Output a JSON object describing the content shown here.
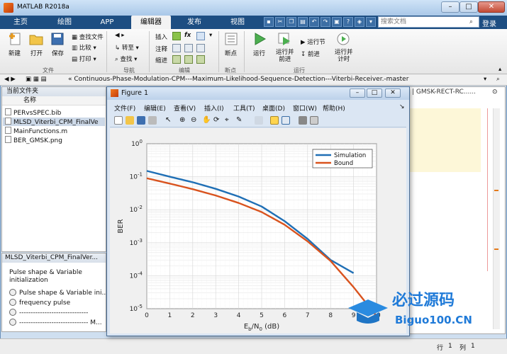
{
  "window": {
    "title": "MATLAB R2018a"
  },
  "tabs": [
    {
      "label": "主页"
    },
    {
      "label": "绘图"
    },
    {
      "label": "APP"
    },
    {
      "label": "编辑器"
    },
    {
      "label": "发布"
    },
    {
      "label": "视图"
    }
  ],
  "search": {
    "placeholder": "搜索文档"
  },
  "login_label": "登录",
  "ribbon": {
    "file": {
      "new": "新建",
      "open": "打开",
      "save": "保存",
      "find_files": "查找文件",
      "compare": "比较",
      "print": "打印",
      "section": "文件"
    },
    "nav": {
      "goto": "转至",
      "find": "查找",
      "section": "导航"
    },
    "edit": {
      "insert": "插入",
      "comment": "注释",
      "indent": "缩进",
      "fx": "fx",
      "section": "编辑"
    },
    "breakpoints": {
      "label": "断点",
      "section": "断点"
    },
    "run": {
      "run": "运行",
      "run_advance": "运行并\n前进",
      "run_section": "运行节",
      "advance": "前进",
      "run_time": "运行并\n计时",
      "section": "运行"
    }
  },
  "address": {
    "path": "« Continuous-Phase-Modulation-CPM---Maximum-Likelihood-Sequence-Detection---Viterbi-Receiver.-master"
  },
  "current_folder": {
    "title": "当前文件夹",
    "column": "名称",
    "files": [
      {
        "name": "PERvsSPEC.bib"
      },
      {
        "name": "MLSD_Viterbi_CPM_FinalVe"
      },
      {
        "name": "MainFunctions.m"
      },
      {
        "name": "BER_GMSK.png"
      }
    ]
  },
  "details": {
    "title": "MLSD_Viterbi_CPM_FinalVer...",
    "desc_line1": "Pulse shape & Variable",
    "desc_line2": "initialization",
    "items": [
      "Pulse shape & Variable ini...",
      "frequency pulse",
      "------------------------------",
      "------------------------------ M..."
    ]
  },
  "editor": {
    "crumb": "| GMSK-RECT-RC......"
  },
  "status": {
    "row_label": "行",
    "row": "1",
    "col_label": "列",
    "col": "1"
  },
  "figure": {
    "title": "Figure 1",
    "menu": [
      "文件(F)",
      "编辑(E)",
      "查看(V)",
      "插入(I)",
      "工具(T)",
      "桌面(D)",
      "窗口(W)",
      "帮助(H)"
    ]
  },
  "chart_data": {
    "type": "line",
    "title": "",
    "xlabel": "Eb/N0 (dB)",
    "ylabel": "BER",
    "xlim": [
      0,
      10
    ],
    "ylim_log10": [
      -5,
      0
    ],
    "yscale": "log",
    "grid": true,
    "legend_position": "top-right",
    "x_ticks": [
      "0",
      "1",
      "2",
      "3",
      "4",
      "5",
      "6",
      "7",
      "8",
      "9",
      "10"
    ],
    "y_ticks": [
      "10^0",
      "10^-1",
      "10^-2",
      "10^-3",
      "10^-4",
      "10^-5"
    ],
    "series": [
      {
        "name": "Simulation",
        "color": "#1f6fb5",
        "x": [
          0,
          1,
          2,
          3,
          4,
          5,
          6,
          7,
          8,
          9
        ],
        "y": [
          0.15,
          0.1,
          0.068,
          0.043,
          0.025,
          0.0125,
          0.0045,
          0.0013,
          0.0003,
          0.00012
        ]
      },
      {
        "name": "Bound",
        "color": "#d9531e",
        "x": [
          0,
          1,
          2,
          3,
          4,
          5,
          6,
          7,
          8,
          9,
          10
        ],
        "y": [
          0.09,
          0.062,
          0.042,
          0.027,
          0.016,
          0.0085,
          0.0035,
          0.0011,
          0.00028,
          4.5e-05,
          6e-06
        ]
      }
    ]
  },
  "watermark": {
    "text": "必过源码",
    "sub": "Biguo100.CN"
  }
}
